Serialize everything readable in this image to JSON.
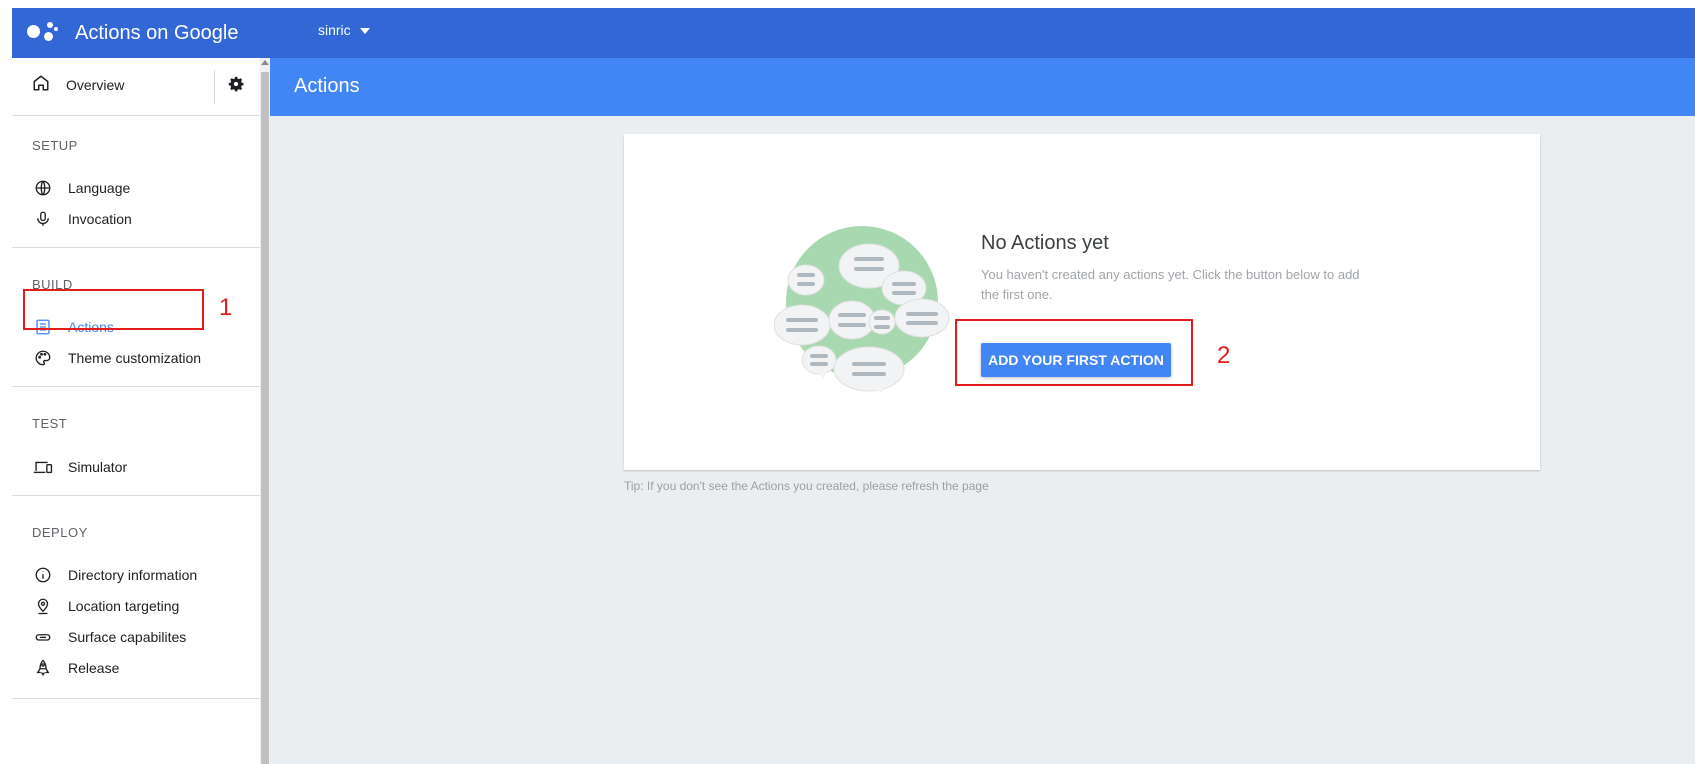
{
  "app": {
    "title": "Actions on Google"
  },
  "project": {
    "name": "sinric"
  },
  "sidebar": {
    "overview": {
      "label": "Overview"
    },
    "sections": {
      "setup": {
        "label": "SETUP",
        "items": [
          "Language",
          "Invocation"
        ]
      },
      "build": {
        "label": "BUILD",
        "items": [
          "Actions",
          "Theme customization"
        ]
      },
      "test": {
        "label": "TEST",
        "items": [
          "Simulator"
        ]
      },
      "deploy": {
        "label": "DEPLOY",
        "items": [
          "Directory information",
          "Location targeting",
          "Surface capabilites",
          "Release"
        ]
      }
    },
    "active_item": "Actions"
  },
  "page": {
    "title": "Actions"
  },
  "empty_state": {
    "title": "No Actions yet",
    "description": "You haven't created any actions yet. Click the button below to add the first one.",
    "button_label": "ADD YOUR FIRST ACTION"
  },
  "tip": "Tip: If you don't see the Actions you created, please refresh the page",
  "annotations": {
    "first": "1",
    "second": "2"
  },
  "colors": {
    "topbar": "#3367d6",
    "header": "#4285f4",
    "accent": "#4285f4",
    "annotation": "#e31c1c",
    "illustration_circle": "#a8d8b0"
  },
  "icons": {
    "overview": "home-icon",
    "settings": "gear-icon",
    "language": "globe-icon",
    "invocation": "microphone-icon",
    "actions": "list-doc-icon",
    "theme": "palette-icon",
    "simulator": "devices-icon",
    "directory": "info-icon",
    "location": "location-pin-icon",
    "surface": "link-capsule-icon",
    "release": "rocket-icon"
  }
}
